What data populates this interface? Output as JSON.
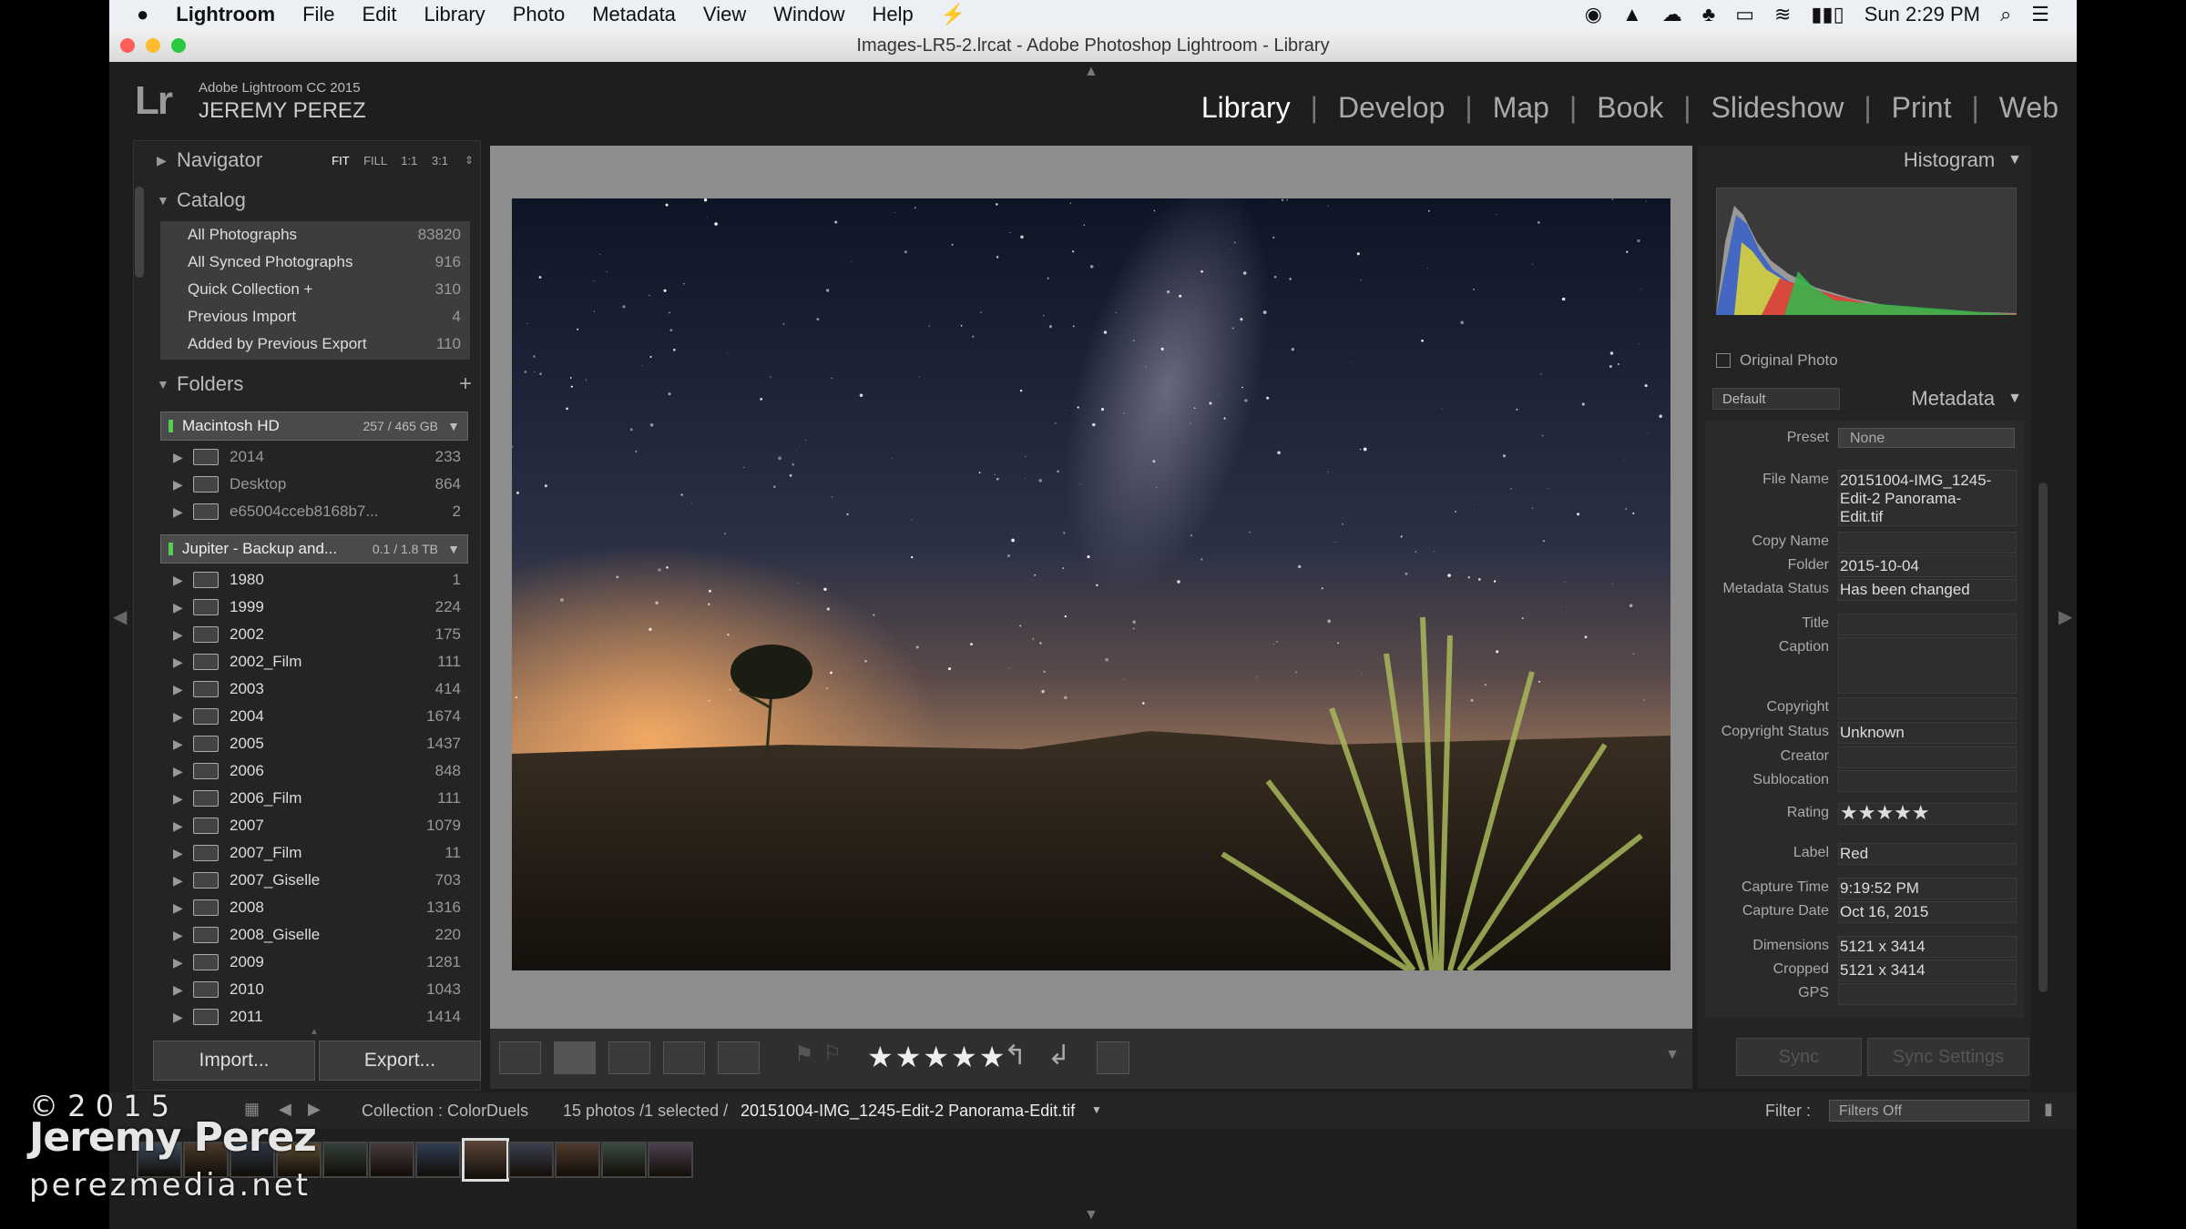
{
  "menubar": {
    "items": [
      "Lightroom",
      "File",
      "Edit",
      "Library",
      "Photo",
      "Metadata",
      "View",
      "Window",
      "Help"
    ],
    "clock": "Sun 2:29 PM"
  },
  "window": {
    "title": "Images-LR5-2.lrcat - Adobe Photoshop Lightroom - Library"
  },
  "identity": {
    "product": "Adobe Lightroom CC 2015",
    "user": "JEREMY PEREZ",
    "logo": "Lr"
  },
  "modules": [
    "Library",
    "Develop",
    "Map",
    "Book",
    "Slideshow",
    "Print",
    "Web"
  ],
  "active_module": "Library",
  "navigator": {
    "title": "Navigator",
    "zoom": [
      "FIT",
      "FILL",
      "1:1",
      "3:1"
    ]
  },
  "catalog": {
    "title": "Catalog",
    "items": [
      {
        "label": "All Photographs",
        "count": "83820"
      },
      {
        "label": "All Synced Photographs",
        "count": "916"
      },
      {
        "label": "Quick Collection +",
        "count": "310"
      },
      {
        "label": "Previous Import",
        "count": "4"
      },
      {
        "label": "Added by Previous Export",
        "count": "110"
      }
    ]
  },
  "folders": {
    "title": "Folders",
    "volumes": [
      {
        "name": "Macintosh HD",
        "size": "257 / 465 GB"
      },
      {
        "name": "Jupiter - Backup and...",
        "size": "0.1 / 1.8 TB"
      }
    ],
    "vol1_items": [
      {
        "label": "2014",
        "count": "233"
      },
      {
        "label": "Desktop",
        "count": "864"
      },
      {
        "label": "e65004cceb8168b7...",
        "count": "2"
      }
    ],
    "vol2_items": [
      {
        "label": "1980",
        "count": "1"
      },
      {
        "label": "1999",
        "count": "224"
      },
      {
        "label": "2002",
        "count": "175"
      },
      {
        "label": "2002_Film",
        "count": "111"
      },
      {
        "label": "2003",
        "count": "414"
      },
      {
        "label": "2004",
        "count": "1674"
      },
      {
        "label": "2005",
        "count": "1437"
      },
      {
        "label": "2006",
        "count": "848"
      },
      {
        "label": "2006_Film",
        "count": "111"
      },
      {
        "label": "2007",
        "count": "1079"
      },
      {
        "label": "2007_Film",
        "count": "11"
      },
      {
        "label": "2007_Giselle",
        "count": "703"
      },
      {
        "label": "2008",
        "count": "1316"
      },
      {
        "label": "2008_Giselle",
        "count": "220"
      },
      {
        "label": "2009",
        "count": "1281"
      },
      {
        "label": "2010",
        "count": "1043"
      },
      {
        "label": "2011",
        "count": "1414"
      }
    ]
  },
  "buttons": {
    "import": "Import...",
    "export": "Export...",
    "sync": "Sync",
    "sync_settings": "Sync Settings"
  },
  "toolbar": {
    "rating": "★★★★★"
  },
  "histogram": {
    "title": "Histogram",
    "original_photo": "Original Photo"
  },
  "metadata": {
    "title": "Metadata",
    "preset_selector": "Default",
    "preset_label": "Preset",
    "preset_value": "None",
    "fields": [
      {
        "label": "File Name",
        "value": "20151004-IMG_1245-Edit-2 Panorama-Edit.tif"
      },
      {
        "label": "Copy Name",
        "value": ""
      },
      {
        "label": "Folder",
        "value": "2015-10-04"
      },
      {
        "label": "Metadata Status",
        "value": "Has been changed"
      },
      {
        "label": "Title",
        "value": ""
      },
      {
        "label": "Caption",
        "value": ""
      },
      {
        "label": "Copyright",
        "value": ""
      },
      {
        "label": "Copyright Status",
        "value": "Unknown"
      },
      {
        "label": "Creator",
        "value": ""
      },
      {
        "label": "Sublocation",
        "value": ""
      },
      {
        "label": "Rating",
        "value": "★★★★★"
      },
      {
        "label": "Label",
        "value": "Red"
      },
      {
        "label": "Capture Time",
        "value": "9:19:52 PM"
      },
      {
        "label": "Capture Date",
        "value": "Oct 16, 2015"
      },
      {
        "label": "Dimensions",
        "value": "5121 x 3414"
      },
      {
        "label": "Cropped",
        "value": "5121 x 3414"
      },
      {
        "label": "GPS",
        "value": ""
      }
    ]
  },
  "filmbar": {
    "collection": "Collection : ColorDuels",
    "info": "15 photos /1 selected /",
    "filename": "20151004-IMG_1245-Edit-2 Panorama-Edit.tif",
    "filter_label": "Filter :",
    "filter_value": "Filters Off"
  },
  "watermark": {
    "year": "© 2 0 1 5",
    "name": "Jeremy Perez",
    "site": "perezmedia.net"
  }
}
